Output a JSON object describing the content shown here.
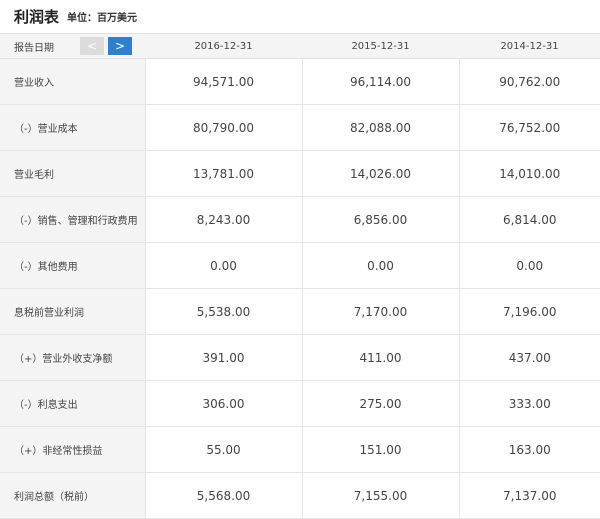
{
  "header": {
    "title": "利润表",
    "unit": "单位：百万美元"
  },
  "table": {
    "date_label": "报告日期",
    "prev_label": "<",
    "next_label": ">",
    "dates": [
      "2016-12-31",
      "2015-12-31",
      "2014-12-31"
    ],
    "rows": [
      {
        "label": "营业收入",
        "values": [
          "94,571.00",
          "96,114.00",
          "90,762.00"
        ]
      },
      {
        "label": "（-）营业成本",
        "values": [
          "80,790.00",
          "82,088.00",
          "76,752.00"
        ]
      },
      {
        "label": "营业毛利",
        "values": [
          "13,781.00",
          "14,026.00",
          "14,010.00"
        ]
      },
      {
        "label": "（-）销售、管理和行政费用",
        "values": [
          "8,243.00",
          "6,856.00",
          "6,814.00"
        ]
      },
      {
        "label": "（-）其他费用",
        "values": [
          "0.00",
          "0.00",
          "0.00"
        ]
      },
      {
        "label": "息税前营业利润",
        "values": [
          "5,538.00",
          "7,170.00",
          "7,196.00"
        ]
      },
      {
        "label": "（+）营业外收支净额",
        "values": [
          "391.00",
          "411.00",
          "437.00"
        ]
      },
      {
        "label": "（-）利息支出",
        "values": [
          "306.00",
          "275.00",
          "333.00"
        ]
      },
      {
        "label": "（+）非经常性损益",
        "values": [
          "55.00",
          "151.00",
          "163.00"
        ]
      },
      {
        "label": "利润总额（税前）",
        "values": [
          "5,568.00",
          "7,155.00",
          "7,137.00"
        ]
      }
    ]
  }
}
